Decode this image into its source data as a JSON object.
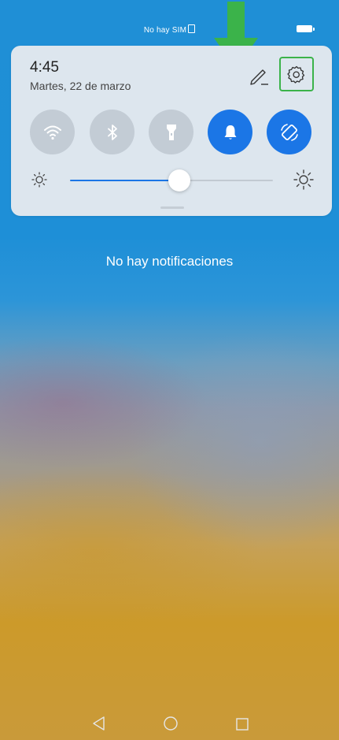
{
  "status_bar": {
    "sim_text": "No hay SIM"
  },
  "quick_settings": {
    "time": "4:45",
    "date": "Martes, 22 de marzo",
    "toggles": [
      {
        "icon": "wifi-icon",
        "state": "off"
      },
      {
        "icon": "bluetooth-icon",
        "state": "off"
      },
      {
        "icon": "flashlight-icon",
        "state": "off"
      },
      {
        "icon": "bell-icon",
        "state": "on"
      },
      {
        "icon": "auto-rotate-icon",
        "state": "on"
      }
    ],
    "brightness_level": 0.54,
    "accent_color": "#1b76e6",
    "highlight_color": "#3bb34a"
  },
  "notifications": {
    "empty_text": "No hay notificaciones"
  }
}
